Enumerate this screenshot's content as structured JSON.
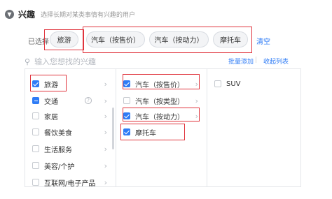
{
  "header": {
    "collapse_icon": "chevron-down-icon",
    "title": "兴趣",
    "description": "选择长期对某类事情有兴趣的用户"
  },
  "selected": {
    "label": "已选择",
    "chips": [
      "旅游",
      "汽车（按售价）",
      "汽车（按动力）",
      "摩托车"
    ],
    "clear": "清空"
  },
  "search": {
    "icon": "search-icon",
    "placeholder": "输入您想找的兴趣"
  },
  "actions": {
    "batch_add": "批量添加",
    "collapse_list": "收起列表"
  },
  "columns": {
    "level1": [
      {
        "label": "旅游",
        "state": "checked"
      },
      {
        "label": "交通",
        "state": "partial"
      },
      {
        "label": "家居",
        "state": "unchecked"
      },
      {
        "label": "餐饮美食",
        "state": "unchecked"
      },
      {
        "label": "生活服务",
        "state": "unchecked"
      },
      {
        "label": "美容/个护",
        "state": "unchecked"
      },
      {
        "label": "互联网/电子产品",
        "state": "unchecked"
      }
    ],
    "level2": [
      {
        "label": "汽车（按售价）",
        "state": "checked"
      },
      {
        "label": "汽车（按类型）",
        "state": "unchecked"
      },
      {
        "label": "汽车（按动力）",
        "state": "checked"
      },
      {
        "label": "摩托车",
        "state": "checked"
      }
    ],
    "level3": [
      {
        "label": "SUV",
        "state": "unchecked"
      }
    ]
  },
  "colors": {
    "accent": "#2f7cf6",
    "highlight": "#e0343d"
  }
}
